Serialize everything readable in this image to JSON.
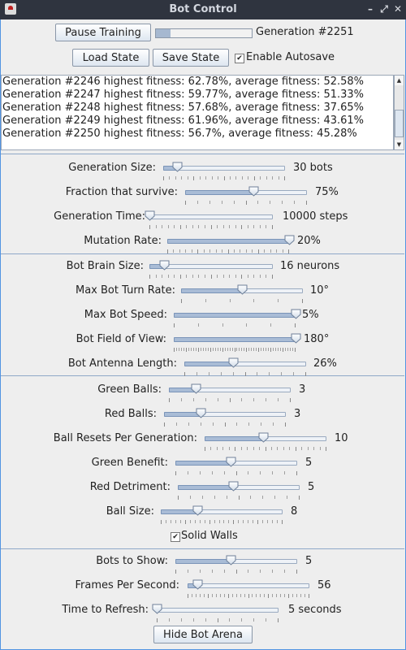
{
  "window": {
    "title": "Bot Control",
    "controls": [
      "minimize",
      "maximize",
      "close"
    ]
  },
  "toolbar": {
    "pause_label": "Pause Training",
    "progress_percent": 15,
    "generation_label": "Generation #2251",
    "load_label": "Load State",
    "save_label": "Save State",
    "autosave_label": "Enable Autosave",
    "autosave_checked": true
  },
  "log": [
    "Generation #2246 highest fitness: 62.78%, average fitness: 52.58%",
    "Generation #2247 highest fitness: 59.77%, average fitness: 51.33%",
    "Generation #2248 highest fitness: 57.68%, average fitness: 37.65%",
    "Generation #2249 highest fitness: 61.96%, average fitness: 43.61%",
    "Generation #2250 highest fitness: 56.7%, average fitness: 45.28%"
  ],
  "sliders": [
    {
      "label": "Generation Size:",
      "value": "30 bots",
      "fraction": 0.11,
      "ticks": 20,
      "major": 5
    },
    {
      "label": "Fraction that survive:",
      "value": "75%",
      "fraction": 0.56,
      "ticks": 10,
      "major": 5
    },
    {
      "label": "Generation Time:",
      "value": "10000 steps",
      "fraction": 0.0,
      "ticks": 20,
      "major": 5
    },
    {
      "label": "Mutation Rate:",
      "value": "20%",
      "fraction": 1.0,
      "ticks": 20,
      "major": 5
    },
    {
      "label": "Bot Brain Size:",
      "value": "16 neurons",
      "fraction": 0.12,
      "ticks": 20,
      "major": 5
    },
    {
      "label": "Max Bot Turn Rate:",
      "value": "10°",
      "fraction": 0.5,
      "ticks": 5,
      "major": 5
    },
    {
      "label": "Max Bot Speed:",
      "value": "5%",
      "fraction": 1.0,
      "ticks": 5,
      "major": 5
    },
    {
      "label": "Bot Field of View:",
      "value": "180°",
      "fraction": 1.0,
      "ticks": 50,
      "major": 5
    },
    {
      "label": "Bot Antenna Length:",
      "value": "26%",
      "fraction": 0.4,
      "ticks": 10,
      "major": 5
    },
    {
      "label": "Green Balls:",
      "value": "3",
      "fraction": 0.22,
      "ticks": 10,
      "major": 5
    },
    {
      "label": "Red Balls:",
      "value": "3",
      "fraction": 0.3,
      "ticks": 10,
      "major": 5
    },
    {
      "label": "Ball Resets Per Generation:",
      "value": "10",
      "fraction": 0.48,
      "ticks": 20,
      "major": 5
    },
    {
      "label": "Green Benefit:",
      "value": "5",
      "fraction": 0.45,
      "ticks": 10,
      "major": 5
    },
    {
      "label": "Red Detriment:",
      "value": "5",
      "fraction": 0.45,
      "ticks": 10,
      "major": 5
    },
    {
      "label": "Ball Size:",
      "value": "8",
      "fraction": 0.3,
      "ticks": 25,
      "major": 5
    },
    {
      "label": "Bots to Show:",
      "value": "5",
      "fraction": 0.45,
      "ticks": 10,
      "major": 5
    },
    {
      "label": "Frames Per Second:",
      "value": "56",
      "fraction": 0.08,
      "ticks": 30,
      "major": 5
    },
    {
      "label": "Time to Refresh:",
      "value": "5 seconds",
      "fraction": 0.0,
      "ticks": 10,
      "major": 5
    }
  ],
  "solid_walls": {
    "label": "Solid Walls",
    "checked": true
  },
  "hide_arena_label": "Hide Bot Arena"
}
